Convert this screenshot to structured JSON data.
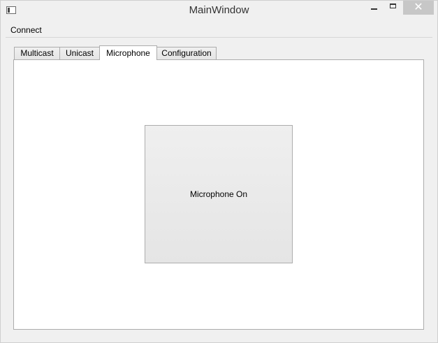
{
  "window": {
    "title": "MainWindow",
    "controls": {
      "minimize_icon": "minimize-icon",
      "maximize_icon": "maximize-icon",
      "close_icon": "close-icon",
      "close_glyph": "✕"
    }
  },
  "menubar": {
    "items": [
      {
        "label": "Connect"
      }
    ]
  },
  "tabs": [
    {
      "label": "Multicast",
      "selected": false
    },
    {
      "label": "Unicast",
      "selected": false
    },
    {
      "label": "Microphone",
      "selected": true
    },
    {
      "label": "Configuration",
      "selected": false
    }
  ],
  "microphone_tab": {
    "toggle_label": "Microphone On"
  },
  "colors": {
    "window_bg": "#f0f0f0",
    "pane_bg": "#ffffff",
    "border": "#acacac",
    "close_button_bg": "#c7c7c7"
  }
}
